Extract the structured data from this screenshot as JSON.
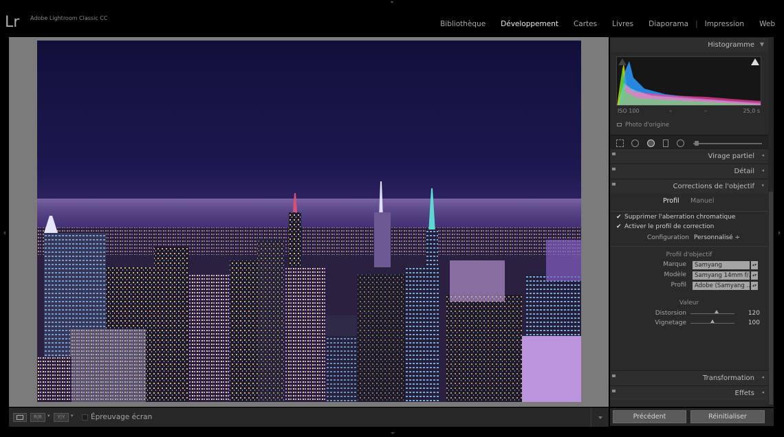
{
  "app": {
    "logo": "Lr",
    "name": "Adobe Lightroom Classic CC"
  },
  "modules": [
    {
      "label": "Bibliothèque",
      "active": false
    },
    {
      "label": "Développement",
      "active": true
    },
    {
      "label": "Cartes",
      "active": false
    },
    {
      "label": "Livres",
      "active": false
    },
    {
      "label": "Diaporama",
      "active": false
    },
    {
      "label": "Impression",
      "active": false
    },
    {
      "label": "Web",
      "active": false
    }
  ],
  "toolbar": {
    "btn2": "R|R",
    "btn3": "Y|Y",
    "proof_label": "Épreuvage écran"
  },
  "histogram": {
    "title": "Histogramme",
    "iso": "ISO 100",
    "dash1": "–",
    "dash2": "–",
    "shutter": "25,0 s",
    "original": "Photo d'origine"
  },
  "panels": {
    "split_toning": "Virage partiel",
    "detail": "Détail",
    "lens": "Corrections de l'objectif",
    "transform": "Transformation",
    "effects": "Effets"
  },
  "lens": {
    "tab_profile": "Profil",
    "tab_manual": "Manuel",
    "check_ca": "Supprimer l'aberration chromatique",
    "check_profile": "Activer le profil de correction",
    "config_label": "Configuration",
    "config_value": "Personnalisé ÷",
    "profile_section": "Profil d'objectif",
    "make_label": "Marque",
    "make_value": "Samyang",
    "model_label": "Modèle",
    "model_value": "Samyang 14mm f/...",
    "profile_label": "Profil",
    "profile_value": "Adobe (Samyang ...",
    "amount_section": "Valeur",
    "distortion_label": "Distorsion",
    "distortion_value": "120",
    "vignetting_label": "Vignetage",
    "vignetting_value": "100"
  },
  "buttons": {
    "previous": "Précédent",
    "reset": "Réinitialiser"
  }
}
